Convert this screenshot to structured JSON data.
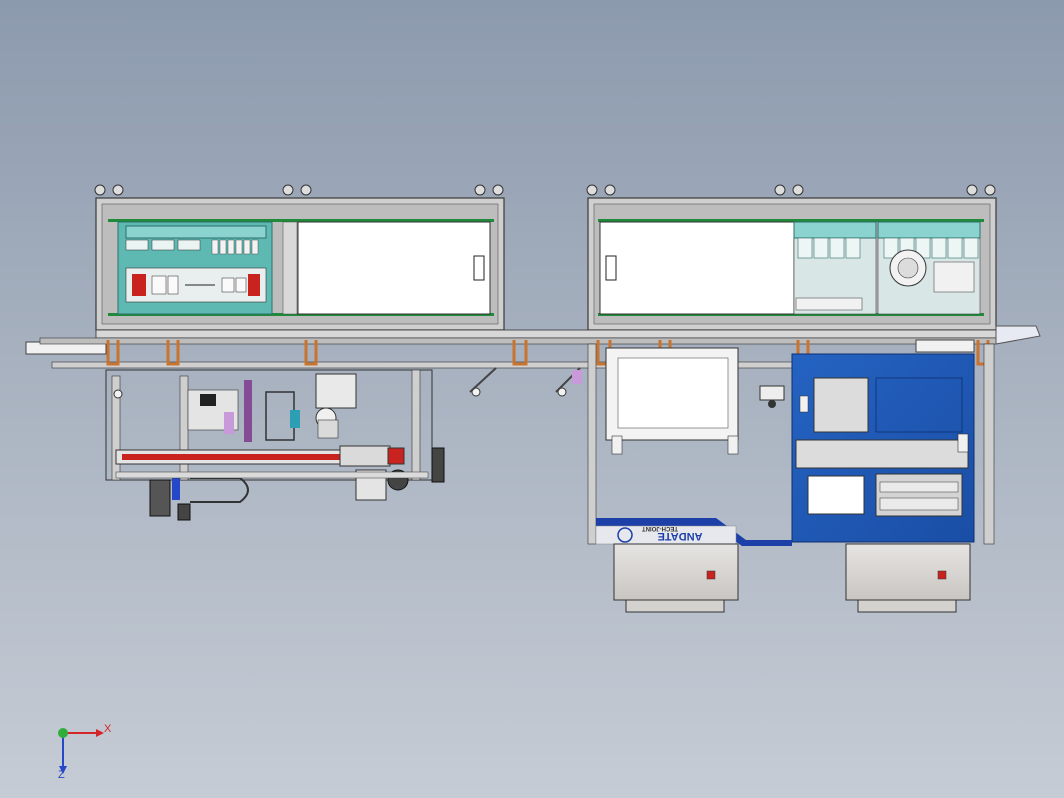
{
  "viewport": {
    "background_top": "#8c9aae",
    "background_bottom": "#c6ccd5"
  },
  "model": {
    "brand_text": "ANDATE",
    "brand_subtext": "TECH-JOINT",
    "colors": {
      "frame": "#c9c9c9",
      "frame_edge": "#3a3a3a",
      "panel_white": "#ffffff",
      "cabinet_teal": "#5fb9b3",
      "cabinet_green": "#1f8a3a",
      "machine_blue": "#1d56b5",
      "machine_blue_dark": "#163f8a",
      "conveyor_orange": "#c8742f",
      "red_accent": "#c8231f",
      "base_grey": "#d8d6d3"
    }
  },
  "triad": {
    "x_label": "X",
    "z_label": "Z",
    "x_color": "#d4262a",
    "y_color": "#2fae3a",
    "z_color": "#2448c8"
  }
}
